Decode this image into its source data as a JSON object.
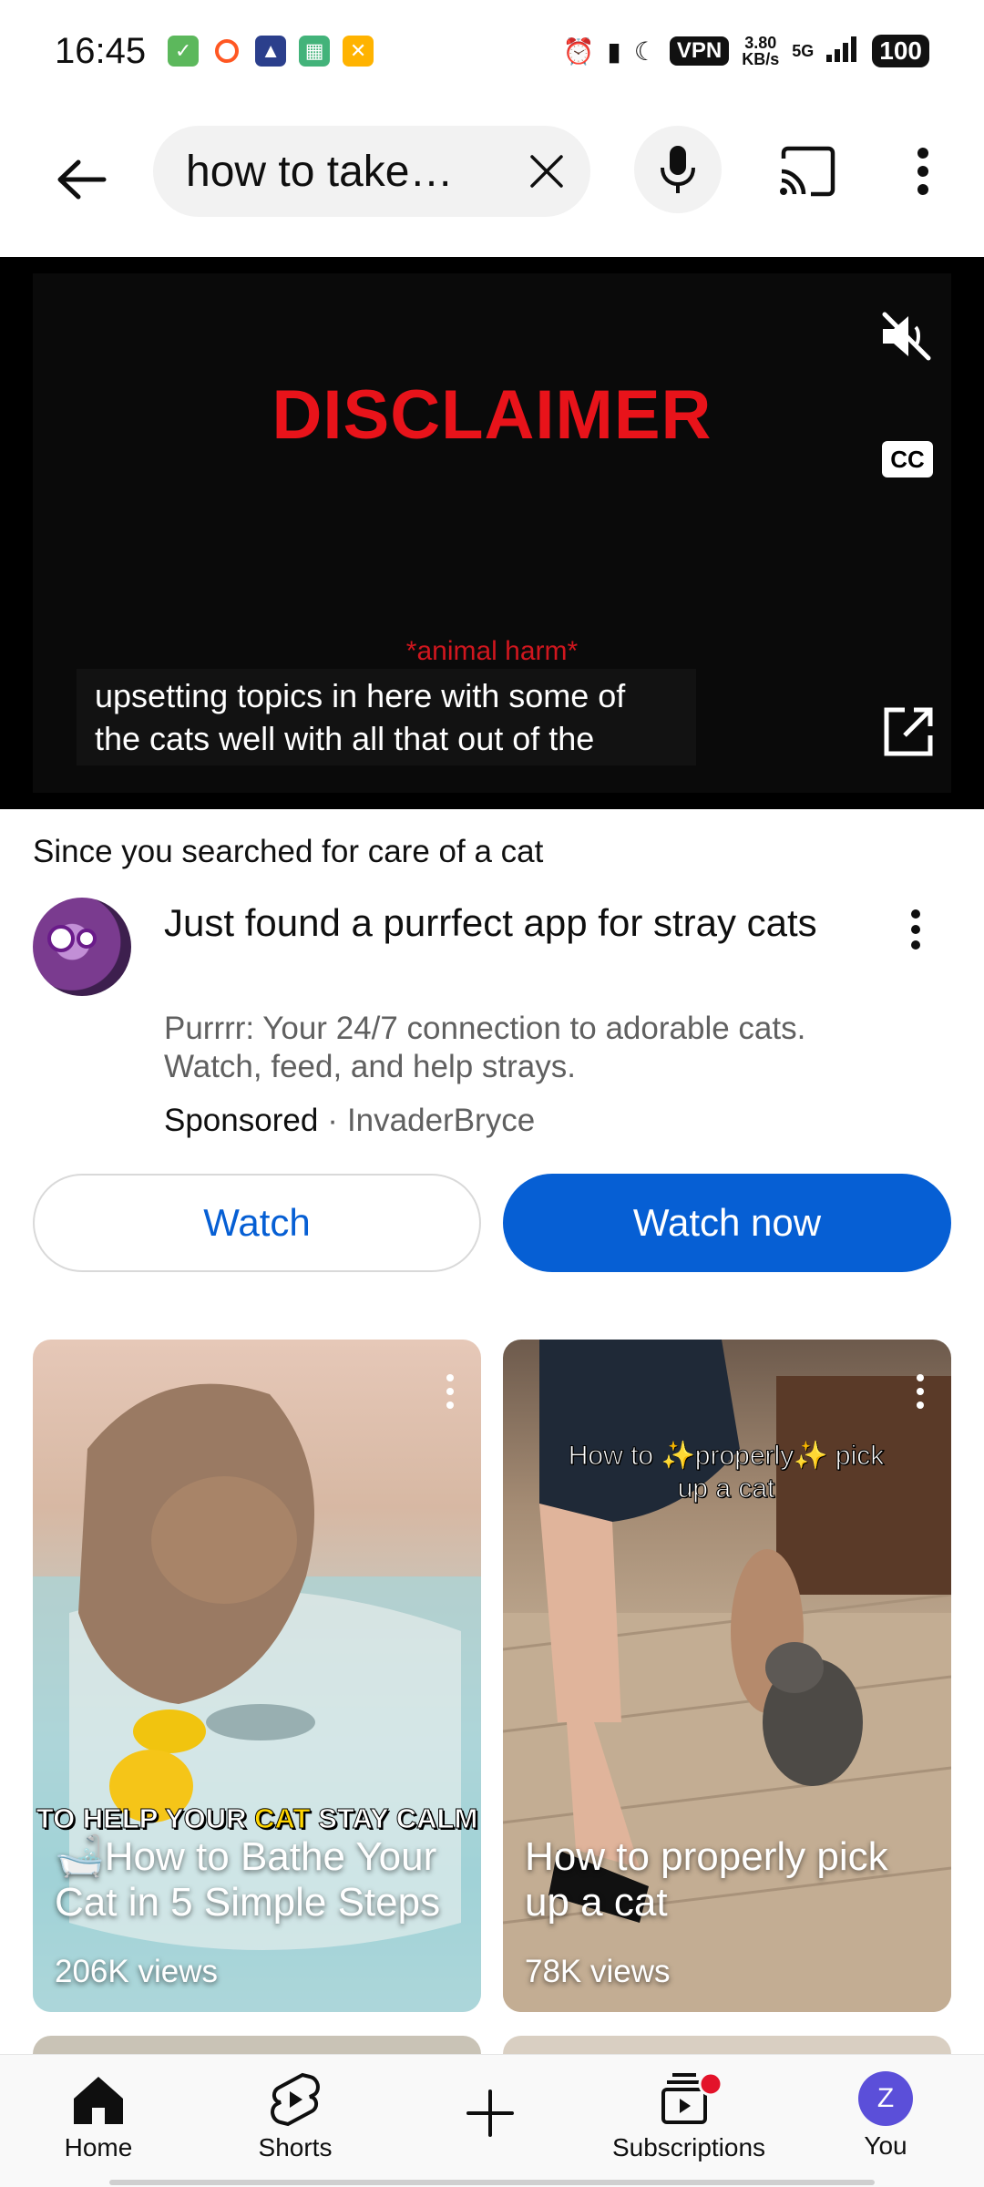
{
  "status_bar": {
    "time": "16:45",
    "vpn": "VPN",
    "net_speed_value": "3.80",
    "net_speed_unit": "KB/s",
    "network": "5G",
    "battery": "100"
  },
  "search": {
    "query": "how to take…"
  },
  "player": {
    "headline": "DISCLAIMER",
    "subline": "*animal harm*",
    "captions_line1": "upsetting topics in here with some of",
    "captions_line2": "the cats well with all that out of the",
    "cc_label": "CC"
  },
  "since": {
    "prefix": "Since you searched for ",
    "term": "care of a cat"
  },
  "ad": {
    "title": "Just found a purrfect app for stray cats",
    "description": "Purrrr: Your 24/7 connection to adorable cats. Watch, feed, and help strays.",
    "sponsored": "Sponsored",
    "separator": "·",
    "channel": "InvaderBryce",
    "watch_label": "Watch",
    "watch_now_label": "Watch now"
  },
  "shorts": [
    {
      "overlay_part1": "TO HELP YOUR ",
      "overlay_highlight": "CAT",
      "overlay_part2": " STAY CALM",
      "title": "🛁How to Bathe Your Cat in 5 Simple Steps",
      "views": "206K views"
    },
    {
      "overlay": "How to ✨properly✨ pick up a cat",
      "title": "How to properly pick up a cat",
      "views": "78K views"
    }
  ],
  "nav": {
    "home": "Home",
    "shorts": "Shorts",
    "subscriptions": "Subscriptions",
    "you": "You",
    "you_initial": "Z"
  },
  "colors": {
    "accent_blue": "#065fd4",
    "disclaimer_red": "#e8131a",
    "notification_dot": "#e3132a"
  }
}
